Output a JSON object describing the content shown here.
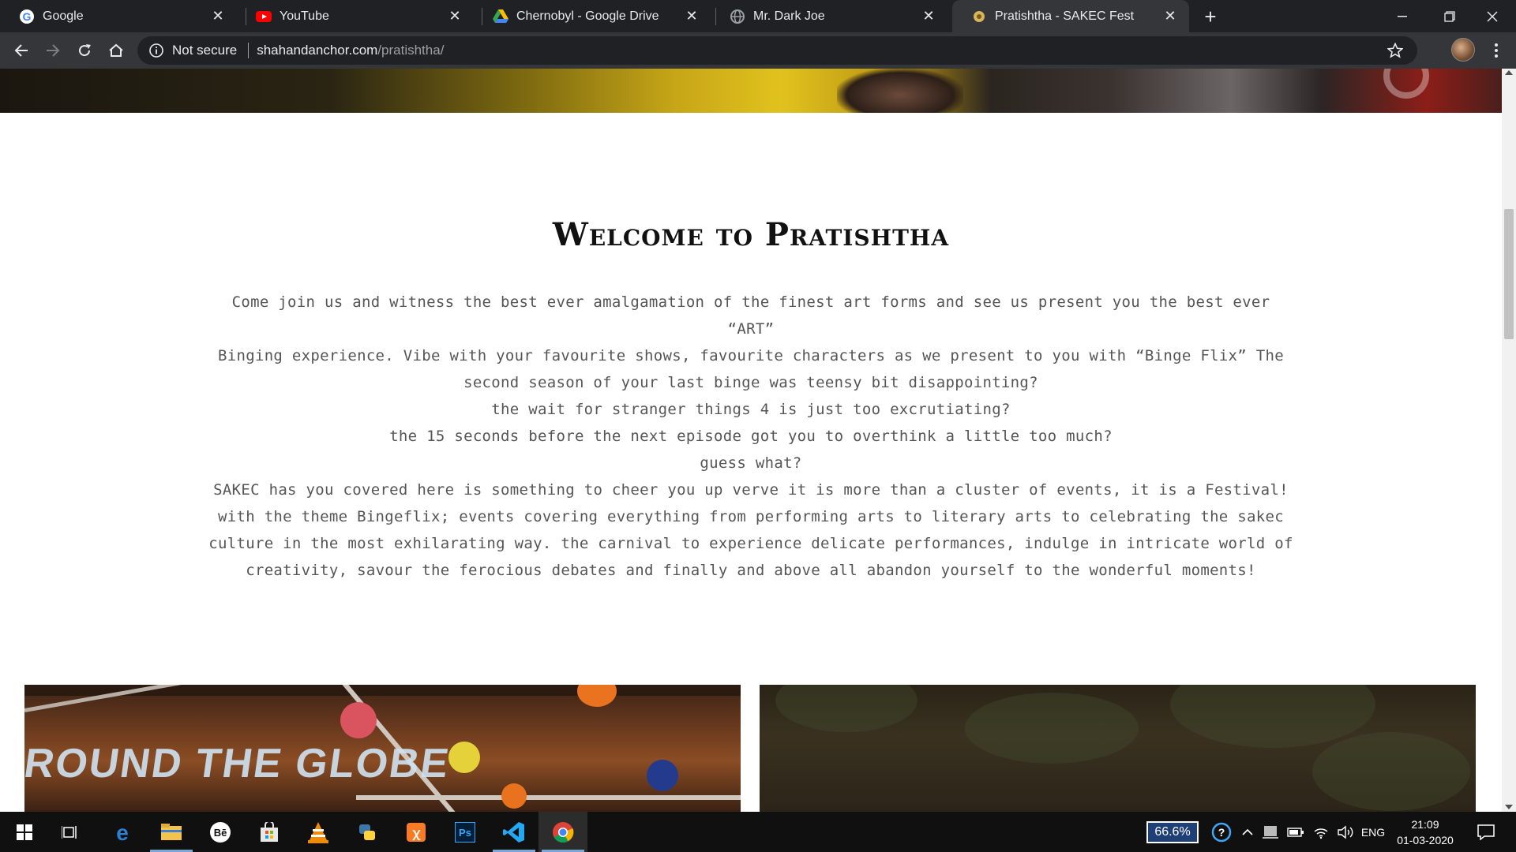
{
  "browser": {
    "tabs": [
      {
        "title": "Google",
        "icon": "google-icon",
        "active": false
      },
      {
        "title": "YouTube",
        "icon": "youtube-icon",
        "active": false
      },
      {
        "title": "Chernobyl - Google Drive",
        "icon": "google-drive-icon",
        "active": false
      },
      {
        "title": "Mr. Dark Joe",
        "icon": "globe-icon",
        "active": false
      },
      {
        "title": "Pratishtha - SAKEC Fest",
        "icon": "site-favicon",
        "active": true
      }
    ],
    "security_label": "Not secure",
    "url_host": "shahandanchor.com",
    "url_path": "/pratishtha/"
  },
  "page": {
    "heading": "Welcome to Pratishtha",
    "paragraph_lines": [
      "Come join us and witness the best ever amalgamation of the finest art forms and see us present you the best ever “ART”",
      "Binging experience. Vibe with your favourite shows, favourite characters as we present to you with “Binge Flix” The",
      "second season of your last binge was teensy bit disappointing?",
      "the wait for stranger things 4 is just too excrutiating?",
      "the 15 seconds before the next episode got you to overthink a little too much?",
      "guess what?",
      "SAKEC has you covered here is something to cheer you up verve it is more than a cluster of events, it is a Festival!",
      "with the theme Bingeflix; events covering everything from performing arts to literary arts to celebrating the sakec",
      "culture in the most exhilarating way. the carnival to experience delicate performances, indulge in intricate world of",
      "creativity, savour the ferocious debates and finally and above all abandon yourself to the wonderful moments!"
    ],
    "photo_left_banner": "ROUND THE GLOBE"
  },
  "taskbar": {
    "zoom_level": "66.6%",
    "language": "ENG",
    "time": "21:09",
    "date": "01-03-2020"
  },
  "colors": {
    "tabstrip_bg": "#202124",
    "toolbar_bg": "#35363a",
    "heading": "#111111",
    "body_text": "#555555",
    "taskbar_bg": "#101010"
  }
}
